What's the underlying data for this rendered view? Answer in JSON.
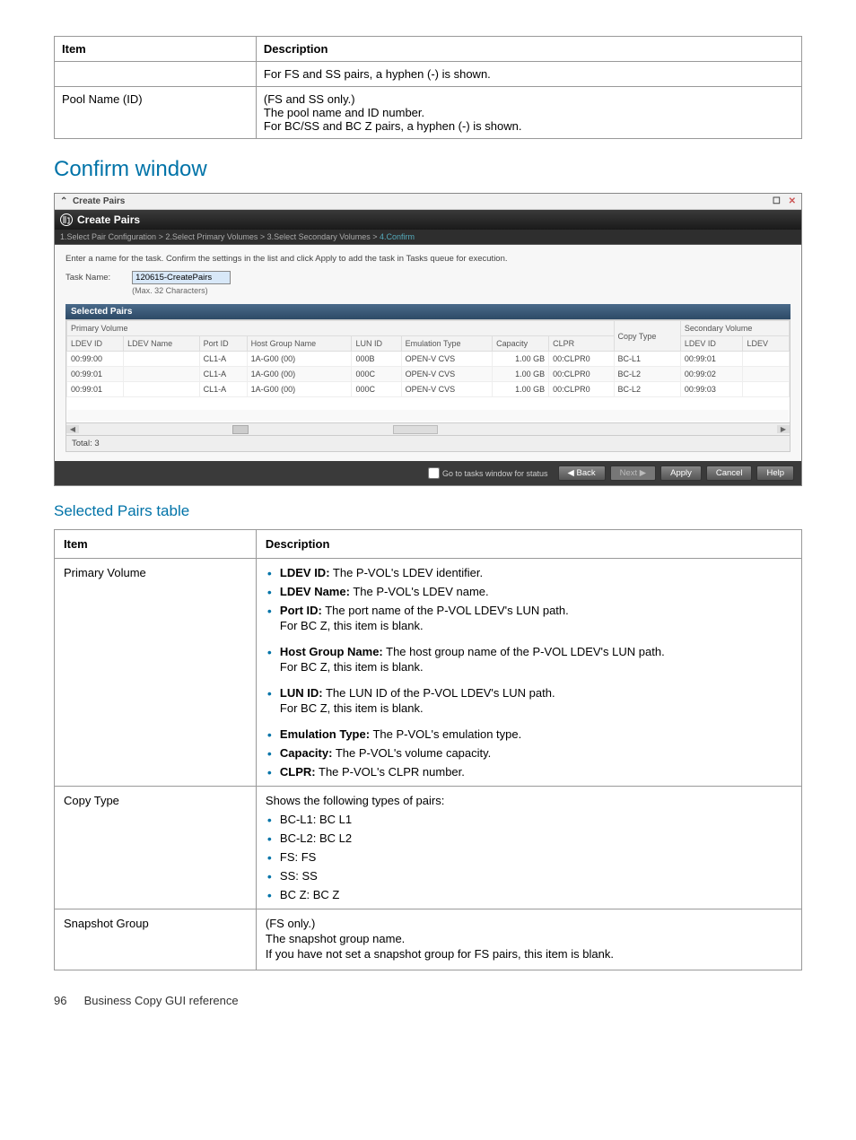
{
  "top_table": {
    "headers": {
      "item": "Item",
      "desc": "Description"
    },
    "rows": [
      {
        "item": "",
        "desc": "For FS and SS pairs, a hyphen (-) is shown."
      },
      {
        "item": "Pool Name (ID)",
        "desc_lines": [
          "(FS and SS only.)",
          "The pool name and ID number.",
          "For BC/SS and BC Z pairs, a hyphen (-) is shown."
        ]
      }
    ]
  },
  "section_title": "Confirm window",
  "dialog": {
    "titlebar": {
      "collapse": "⌃",
      "title": "Create Pairs",
      "max": "☐",
      "close": "✕"
    },
    "header": "Create Pairs",
    "wizard": {
      "s1": "1.Select Pair Configuration",
      "s2": "2.Select Primary Volumes",
      "s3": "3.Select Secondary Volumes",
      "s4": "4.Confirm",
      "sep": "  >  "
    },
    "instruction": "Enter a name for the task. Confirm the settings in the list and click Apply to add the task in Tasks queue for execution.",
    "task_name": {
      "label": "Task Name:",
      "value": "120615-CreatePairs",
      "hint": "(Max. 32 Characters)"
    },
    "selected_pairs_label": "Selected Pairs",
    "primary_volume_label": "Primary Volume",
    "secondary_volume_label": "Secondary Volume",
    "columns": {
      "ldev_id": "LDEV ID",
      "ldev_name": "LDEV Name",
      "port_id": "Port ID",
      "host_group": "Host Group Name",
      "lun_id": "LUN ID",
      "emu": "Emulation Type",
      "capacity": "Capacity",
      "clpr": "CLPR",
      "copy_type": "Copy Type",
      "sec_ldev_id": "LDEV ID",
      "sec_ldev": "LDEV"
    },
    "rows": [
      {
        "ldev_id": "00:99:00",
        "ldev_name": "",
        "port_id": "CL1-A",
        "host_group": "1A-G00 (00)",
        "lun_id": "000B",
        "emu": "OPEN-V CVS",
        "capacity": "1.00 GB",
        "clpr": "00:CLPR0",
        "copy_type": "BC-L1",
        "sec_ldev_id": "00:99:01"
      },
      {
        "ldev_id": "00:99:01",
        "ldev_name": "",
        "port_id": "CL1-A",
        "host_group": "1A-G00 (00)",
        "lun_id": "000C",
        "emu": "OPEN-V CVS",
        "capacity": "1.00 GB",
        "clpr": "00:CLPR0",
        "copy_type": "BC-L2",
        "sec_ldev_id": "00:99:02"
      },
      {
        "ldev_id": "00:99:01",
        "ldev_name": "",
        "port_id": "CL1-A",
        "host_group": "1A-G00 (00)",
        "lun_id": "000C",
        "emu": "OPEN-V CVS",
        "capacity": "1.00 GB",
        "clpr": "00:CLPR0",
        "copy_type": "BC-L2",
        "sec_ldev_id": "00:99:03"
      }
    ],
    "total": "Total: 3",
    "footer": {
      "check": "Go to tasks window for status",
      "back": "◀ Back",
      "next": "Next ▶",
      "apply": "Apply",
      "cancel": "Cancel",
      "help": "Help"
    }
  },
  "subsection_title": "Selected Pairs table",
  "desc_table": {
    "headers": {
      "item": "Item",
      "desc": "Description"
    },
    "rows": [
      {
        "item": "Primary Volume",
        "bullets": [
          {
            "bold": "LDEV ID:",
            "text": " The P-VOL's LDEV identifier."
          },
          {
            "bold": "LDEV Name:",
            "text": " The P-VOL's LDEV name."
          },
          {
            "bold": "Port ID:",
            "text": " The port name of the P-VOL LDEV's LUN path.",
            "sub": "For BC Z, this item is blank.",
            "spaced": true
          },
          {
            "bold": "Host Group Name:",
            "text": " The host group name of the P-VOL LDEV's LUN path.",
            "sub": "For BC Z, this item is blank.",
            "spaced": true
          },
          {
            "bold": "LUN ID:",
            "text": " The LUN ID of the P-VOL LDEV's LUN path.",
            "sub": "For BC Z, this item is blank.",
            "spaced": true
          },
          {
            "bold": "Emulation Type:",
            "text": " The P-VOL's emulation type."
          },
          {
            "bold": "Capacity:",
            "text": " The P-VOL's volume capacity."
          },
          {
            "bold": "CLPR:",
            "text": " The P-VOL's CLPR number."
          }
        ]
      },
      {
        "item": "Copy Type",
        "intro": "Shows the following types of pairs:",
        "bullets": [
          {
            "text": "BC-L1: BC L1"
          },
          {
            "text": "BC-L2: BC L2"
          },
          {
            "text": "FS: FS"
          },
          {
            "text": "SS: SS"
          },
          {
            "text": "BC Z: BC Z"
          }
        ]
      },
      {
        "item": "Snapshot Group",
        "lines": [
          "(FS only.)",
          "The snapshot group name.",
          "If you have not set a snapshot group for FS pairs, this item is blank."
        ]
      }
    ]
  },
  "footer": {
    "page": "96",
    "title": "Business Copy GUI reference"
  }
}
